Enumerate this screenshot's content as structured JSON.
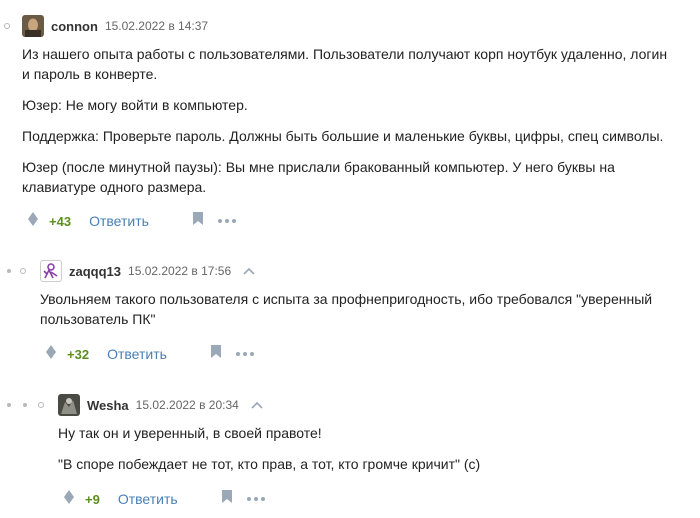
{
  "comments": [
    {
      "author": "connon",
      "date": "15.02.2022 в 14:37",
      "paragraphs": [
        "Из нашего опыта работы с пользователями. Пользователи получают корп ноутбук удаленно, логин и пароль в конверте.",
        "Юзер: Не могу войти в компьютер.",
        "Поддержка: Проверьте пароль. Должны быть большие и маленькие буквы, цифры, спец символы.",
        "Юзер (после минутной паузы): Вы мне прислали бракованный компьютер. У него буквы на клавиатуре одного размера."
      ],
      "score": "+43",
      "reply_label": "Ответить"
    },
    {
      "author": "zaqqq13",
      "date": "15.02.2022 в 17:56",
      "paragraphs": [
        "Увольняем такого пользователя с испыта за профнепригодность, ибо требовался \"уверенный пользователь ПК\""
      ],
      "score": "+32",
      "reply_label": "Ответить"
    },
    {
      "author": "Wesha",
      "date": "15.02.2022 в 20:34",
      "paragraphs": [
        "Ну так он и уверенный, в своей правоте!",
        "\"В споре побеждает не тот, кто прав, а тот, кто громче кричит\" (с)"
      ],
      "score": "+9",
      "reply_label": "Ответить"
    }
  ],
  "colors": {
    "score": "#5c8f1e",
    "reply": "#4a7fb5",
    "icon": "#9aa8b8"
  },
  "icons": [
    "rating-diamond-icon",
    "bookmark-icon",
    "more-icon",
    "collapse-chevron-icon"
  ]
}
